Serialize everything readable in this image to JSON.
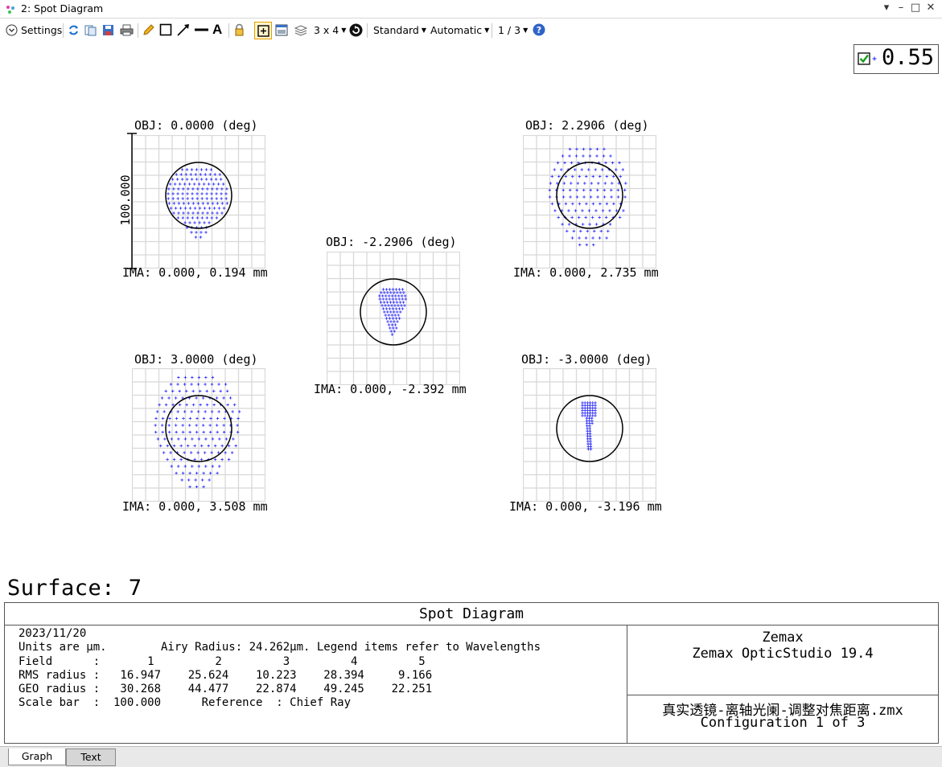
{
  "window": {
    "title": "2: Spot Diagram",
    "controls": [
      "▾",
      "–",
      "□",
      "✕"
    ]
  },
  "toolbar": {
    "settings_label": "Settings",
    "layout_label": "3 x 4",
    "standard_label": "Standard",
    "automatic_label": "Automatic",
    "page_label": "1 / 3"
  },
  "legend_wavelength": "0.55",
  "fields": [
    {
      "obj": "OBJ: 0.0000 (deg)",
      "ima": "IMA: 0.000, 0.194 mm"
    },
    {
      "obj": "OBJ: 2.2906 (deg)",
      "ima": "IMA: 0.000, 2.735 mm"
    },
    {
      "obj": "OBJ: -2.2906 (deg)",
      "ima": "IMA: 0.000, -2.392 mm"
    },
    {
      "obj": "OBJ: 3.0000 (deg)",
      "ima": "IMA: 0.000, 3.508 mm"
    },
    {
      "obj": "OBJ: -3.0000 (deg)",
      "ima": "IMA: 0.000, -3.196 mm"
    }
  ],
  "scale_bar_label": "100.000",
  "surface_label": "Surface: 7",
  "colors": {
    "ray": "#2020ff",
    "grid": "#d8d8d8",
    "circle": "#000000"
  },
  "info": {
    "heading": "Spot Diagram",
    "lines": [
      "2023/11/20",
      "Units are µm.        Airy Radius: 24.262µm. Legend items refer to Wavelengths",
      "Field      :       1         2         3         4         5",
      "RMS radius :   16.947    25.624    10.223    28.394     9.166",
      "GEO radius :   30.268    44.477    22.874    49.245    22.251",
      "Scale bar  :  100.000      Reference  : Chief Ray"
    ],
    "company": "Zemax",
    "product": "Zemax OpticStudio 19.4",
    "filename": "真实透镜-离轴光阑-调整对焦距离.zmx",
    "configuration": "Configuration 1 of 3"
  },
  "tabs": [
    "Graph",
    "Text"
  ]
}
